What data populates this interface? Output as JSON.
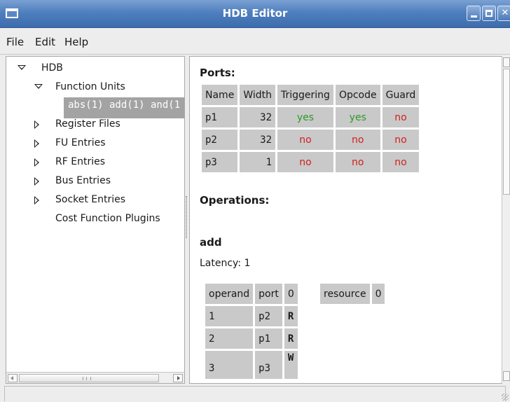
{
  "window": {
    "title": "HDB Editor"
  },
  "menu": {
    "file": "File",
    "edit": "Edit",
    "help": "Help"
  },
  "tree": {
    "root": "HDB",
    "function_units": "Function Units",
    "fu_entries_text": "abs(1) add(1) and(1",
    "register_files": "Register Files",
    "fu_entries": "FU Entries",
    "rf_entries": "RF Entries",
    "bus_entries": "Bus Entries",
    "socket_entries": "Socket Entries",
    "cost_function_plugins": "Cost Function Plugins"
  },
  "ports": {
    "heading": "Ports:",
    "headers": [
      "Name",
      "Width",
      "Triggering",
      "Opcode",
      "Guard"
    ],
    "rows": [
      [
        "p1",
        "32",
        "yes",
        "yes",
        "no"
      ],
      [
        "p2",
        "32",
        "no",
        "no",
        "no"
      ],
      [
        "p3",
        "1",
        "no",
        "no",
        "no"
      ]
    ]
  },
  "operations": {
    "heading": "Operations:",
    "name": "add",
    "latency": "Latency: 1",
    "table_headers": [
      "operand",
      "port",
      "0"
    ],
    "rows": [
      [
        "1",
        "p2",
        "R"
      ],
      [
        "2",
        "p1",
        "R"
      ],
      [
        "3",
        "p3",
        "W"
      ]
    ],
    "resource_headers": [
      "resource",
      "0"
    ]
  },
  "colors": {
    "yes": "#2c9a2c",
    "no": "#d21f1f",
    "titlebar": "#4f7fbf",
    "selection": "#a3a3a3"
  }
}
